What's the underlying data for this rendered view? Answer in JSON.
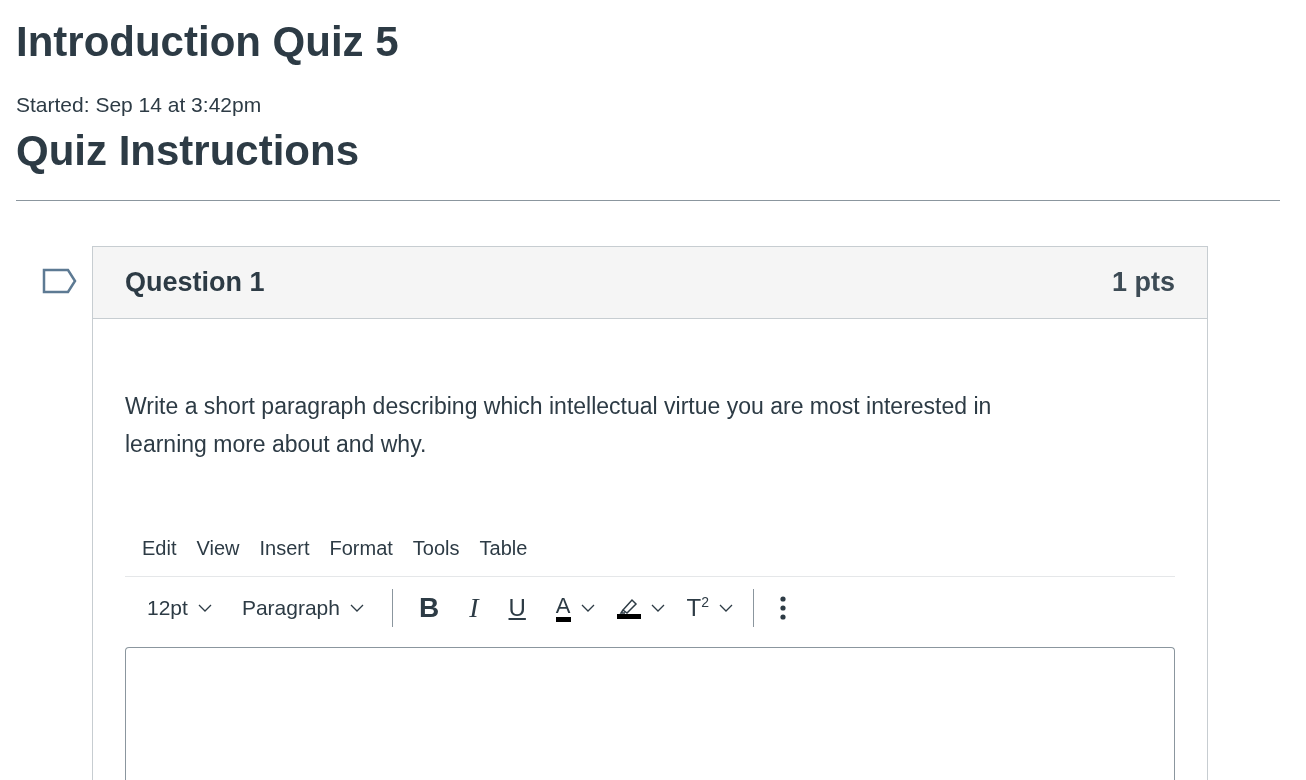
{
  "title": "Introduction Quiz 5",
  "started": "Started: Sep 14 at 3:42pm",
  "instructions_heading": "Quiz Instructions",
  "question": {
    "flagged": false,
    "title": "Question 1",
    "points": "1 pts",
    "text": "Write a short paragraph describing which intellectual virtue you are most interested in learning more about and why.",
    "editor": {
      "menu": [
        "Edit",
        "View",
        "Insert",
        "Format",
        "Tools",
        "Table"
      ],
      "toolbar": [
        {
          "kind": "dropdown",
          "label": "12pt"
        },
        {
          "kind": "dropdown",
          "label": "Paragraph"
        },
        {
          "kind": "divider"
        },
        {
          "kind": "bold",
          "label": "B"
        },
        {
          "kind": "italic",
          "label": "I"
        },
        {
          "kind": "underline",
          "label": "U"
        },
        {
          "kind": "text-color",
          "label": "A"
        },
        {
          "kind": "highlight"
        },
        {
          "kind": "superscript",
          "label": "T",
          "sup": "2"
        },
        {
          "kind": "divider"
        },
        {
          "kind": "more"
        }
      ]
    }
  }
}
